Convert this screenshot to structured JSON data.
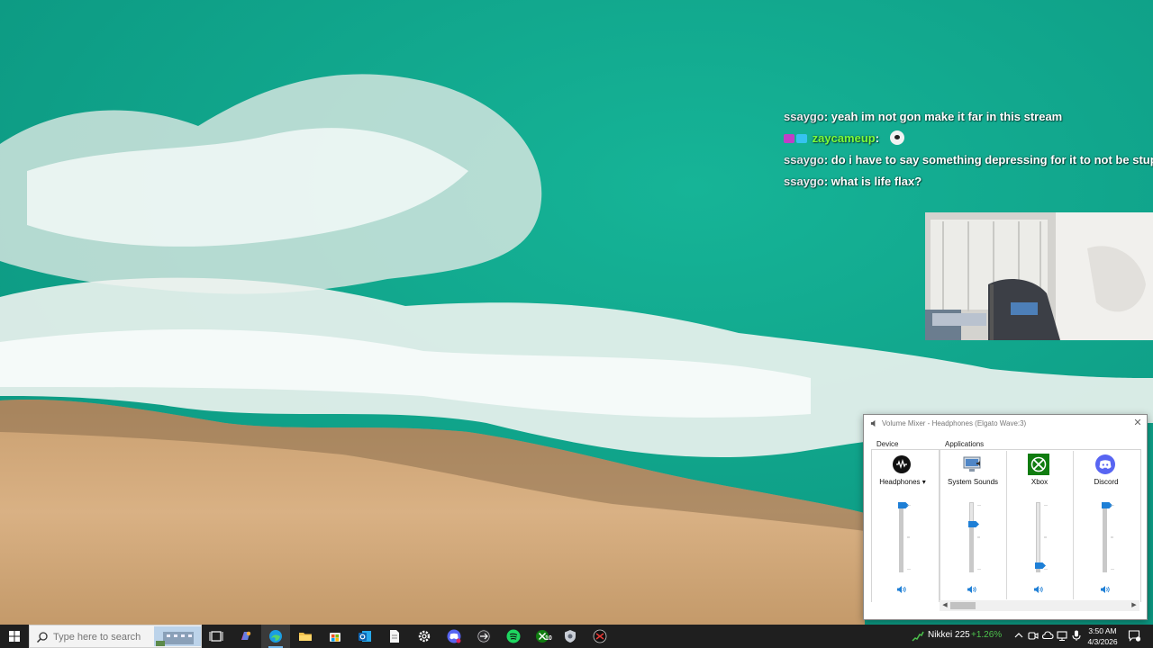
{
  "chat": {
    "messages": [
      {
        "user": "ssaygo",
        "text": "yeah im not gon make it far in this stream"
      },
      {
        "user": "zaycameup",
        "text": ""
      },
      {
        "user": "ssaygo",
        "text": "do i have to say something depressing for it to not be stupid"
      },
      {
        "user": "ssaygo",
        "text": "what is life flax?"
      }
    ],
    "separator": ":"
  },
  "mixer": {
    "title": "Volume Mixer - Headphones (Elgato Wave:3)",
    "close_glyph": "✕",
    "device_label": "Device",
    "applications_label": "Applications",
    "channels": [
      {
        "name": "Headphones",
        "icon": "elgato-icon",
        "volume": 1.0
      },
      {
        "name": "System Sounds",
        "icon": "system-sounds-icon",
        "volume": 0.7
      },
      {
        "name": "Xbox",
        "icon": "xbox-icon",
        "volume": 0.05
      },
      {
        "name": "Discord",
        "icon": "discord-icon",
        "volume": 1.0
      }
    ],
    "scroll_left": "◀",
    "scroll_right": "▶"
  },
  "taskbar": {
    "search_placeholder": "Type here to search",
    "apps": [
      "task-view-icon",
      "copilot-icon",
      "edge-icon",
      "file-explorer-icon",
      "microsoft-store-icon",
      "outlook-icon",
      "notepad-icon",
      "settings-icon",
      "discord-icon",
      "obs-icon",
      "spotify-icon",
      "xbox-icon",
      "vpn-icon",
      "cheat-engine-icon"
    ],
    "xbox_badge": "10",
    "ticker_name": "Nikkei 225",
    "ticker_change": "+1.26%",
    "time": "3:50 AM",
    "date": "4/3/2026"
  },
  "colors": {
    "accent": "#1e7fd6",
    "chat_green": "#7bff3a",
    "ticker_up": "#4cc24c",
    "taskbar_bg": "#1f1f1f"
  }
}
